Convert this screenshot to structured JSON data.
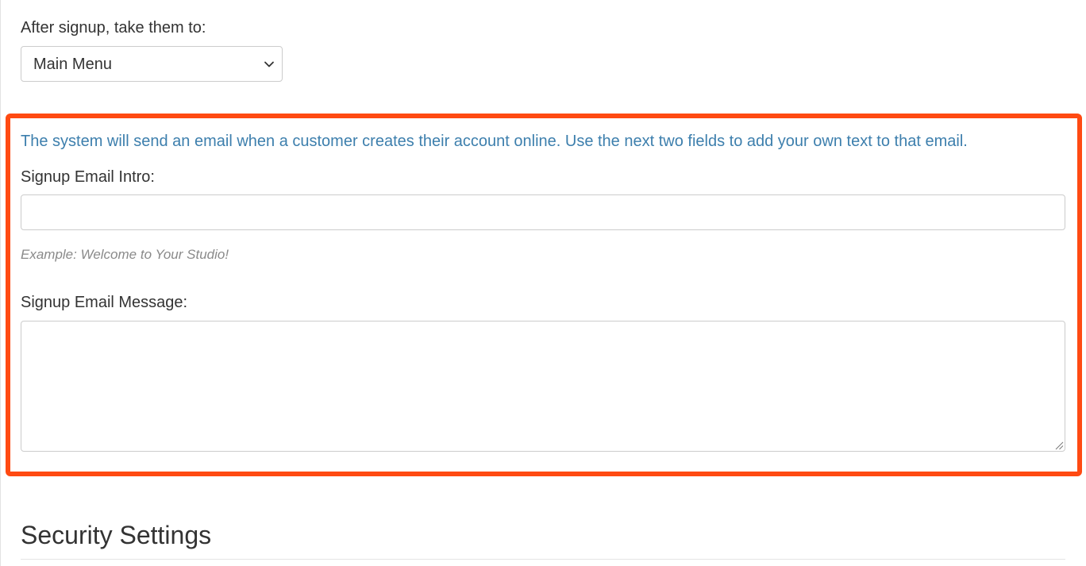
{
  "signup_redirect": {
    "label": "After signup, take them to:",
    "selected_option": "Main Menu"
  },
  "signup_email": {
    "info_text": "The system will send an email when a customer creates their account online. Use the next two fields to add your own text to that email.",
    "intro_label": "Signup Email Intro:",
    "intro_value": "",
    "intro_help": "Example: Welcome to Your Studio!",
    "message_label": "Signup Email Message:",
    "message_value": ""
  },
  "security": {
    "heading": "Security Settings"
  },
  "colors": {
    "highlight_border": "#ff4a12",
    "info_text": "#3d7fad",
    "help_text": "#8a8a8a"
  },
  "icons": {
    "select_chevron": "chevron-down-icon",
    "textarea_resize": "resize-handle-icon"
  }
}
